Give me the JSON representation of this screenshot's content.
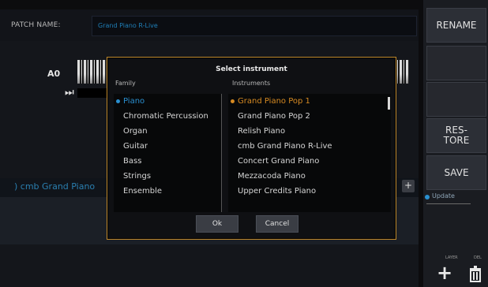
{
  "header": {
    "patch_label": "PATCH NAME:",
    "patch_value": "Grand Piano R-Live"
  },
  "keyboard": {
    "lowest_note": "A0"
  },
  "layer": {
    "name": ") cmb Grand Piano"
  },
  "right_panel": {
    "rename_label": "RENAME",
    "restore_label": "RES-\nTORE",
    "save_label": "SAVE",
    "update_label": "Update",
    "layer_label": "LAYER",
    "del_label": "DEL"
  },
  "dialog": {
    "title": "Select instrument",
    "family_header": "Family",
    "instruments_header": "Instruments",
    "families": [
      "Piano",
      "Chromatic Percussion",
      "Organ",
      "Guitar",
      "Bass",
      "Strings",
      "Ensemble"
    ],
    "instruments": [
      "Grand Piano Pop 1",
      "Grand Piano Pop 2",
      "Relish Piano",
      "cmb Grand Piano R-Live",
      "Concert Grand Piano",
      "Mezzacoda Piano",
      "Upper Credits Piano"
    ],
    "ok_label": "Ok",
    "cancel_label": "Cancel"
  },
  "colors": {
    "accent_blue": "#2a8fd0",
    "accent_orange": "#d68a22",
    "modal_border": "#c08a2e"
  },
  "icons": {
    "add": "plus-icon",
    "delete": "trash-icon",
    "play": "skip-icon"
  }
}
